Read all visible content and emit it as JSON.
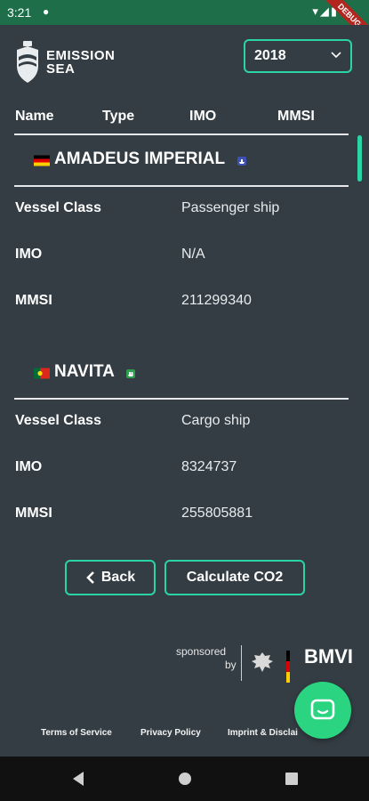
{
  "status": {
    "time": "3:21",
    "debug_banner": "DEBUG"
  },
  "brand": {
    "line1": "EMISSION",
    "line2": "SEA"
  },
  "year_select": {
    "value": "2018"
  },
  "columns": [
    "Name",
    "Type",
    "IMO",
    "MMSI"
  ],
  "ships": [
    {
      "name": "AMADEUS IMPERIAL",
      "flag": "germany",
      "details": [
        {
          "label": "Vessel Class",
          "value": "Passenger ship"
        },
        {
          "label": "IMO",
          "value": "N/A"
        },
        {
          "label": "MMSI",
          "value": "211299340"
        }
      ]
    },
    {
      "name": "NAVITA",
      "flag": "portugal",
      "details": [
        {
          "label": "Vessel Class",
          "value": "Cargo ship"
        },
        {
          "label": "IMO",
          "value": "8324737"
        },
        {
          "label": "MMSI",
          "value": "255805881"
        }
      ]
    }
  ],
  "buttons": {
    "back": "Back",
    "calculate": "Calculate CO2"
  },
  "sponsor": {
    "text_line1": "sponsored",
    "text_line2": "by",
    "logo_text": "BMVI"
  },
  "footer_links": [
    "Terms of Service",
    "Privacy Policy",
    "Imprint & Disclai"
  ],
  "colors": {
    "accent": "#2bd4a4",
    "background": "#333d43",
    "fab": "#2bd480",
    "status_bar": "#1f6e4a"
  },
  "icons": [
    "chat-icon",
    "chevron-down-icon",
    "chevron-left-icon",
    "shield-logo-icon",
    "federal-eagle-icon"
  ]
}
